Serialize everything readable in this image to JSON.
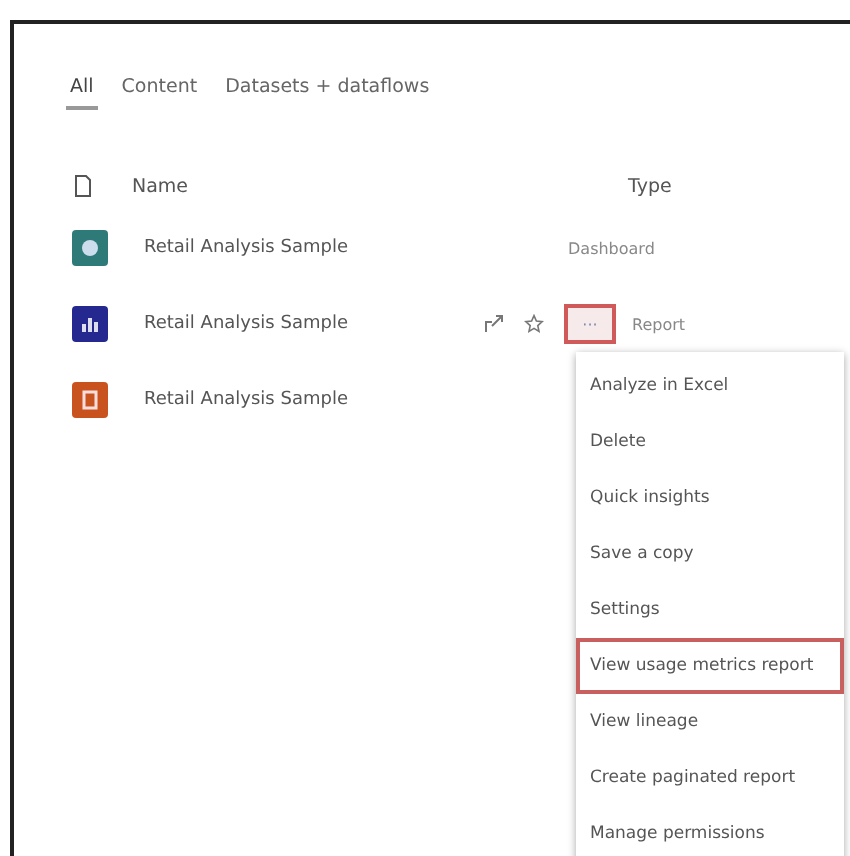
{
  "tabs": [
    {
      "label": "All",
      "selected": true
    },
    {
      "label": "Content",
      "selected": false
    },
    {
      "label": "Datasets + dataflows",
      "selected": false
    }
  ],
  "table": {
    "columns": [
      "Name",
      "Type"
    ],
    "rows": [
      {
        "kind": "dashboard",
        "color": "#2e7a78",
        "name": "Retail Analysis Sample",
        "type": "Dashboard",
        "actions": false
      },
      {
        "kind": "report",
        "color": "#24288f",
        "name": "Retail Analysis Sample",
        "type": "Report",
        "actions": true,
        "more": "···"
      },
      {
        "kind": "dataset",
        "color": "#c9531f",
        "name": "Retail Analysis Sample",
        "actions": false
      }
    ]
  },
  "menu": {
    "items": [
      {
        "label": "Analyze in Excel",
        "selected": false
      },
      {
        "label": "Delete",
        "selected": false
      },
      {
        "label": "Quick insights",
        "selected": false
      },
      {
        "label": "Save a copy",
        "selected": false
      },
      {
        "label": "Settings",
        "selected": false
      },
      {
        "label": "View usage metrics report",
        "selected": true
      },
      {
        "label": "View lineage",
        "selected": false
      },
      {
        "label": "Create paginated report",
        "selected": false
      },
      {
        "label": "Manage permissions",
        "selected": false
      }
    ]
  }
}
